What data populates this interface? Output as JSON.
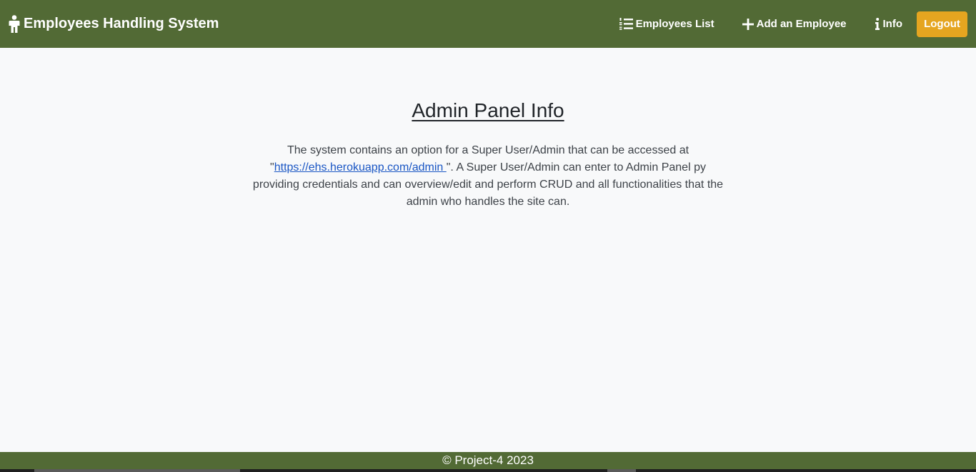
{
  "navbar": {
    "brand": "Employees Handling System",
    "brand_icon": "person-icon",
    "links": [
      {
        "label": "Employees List",
        "icon": "list-ol-icon"
      },
      {
        "label": "Add an Employee",
        "icon": "plus-icon"
      },
      {
        "label": "Info",
        "icon": "info-icon"
      }
    ],
    "logout_label": "Logout",
    "background_color": "#526a35",
    "logout_color": "#e5a520"
  },
  "main": {
    "title": "Admin Panel Info",
    "text_before_link": "The system contains an option for a Super User/Admin that can be accessed at \"",
    "link_text": "https://ehs.herokuapp.com/admin ",
    "text_after_link": "\". A Super User/Admin can enter to Admin Panel py providing credentials and can overview/edit and perform CRUD and all functionalities that the admin who handles the site can."
  },
  "footer": {
    "text": "© Project-4 2023"
  }
}
